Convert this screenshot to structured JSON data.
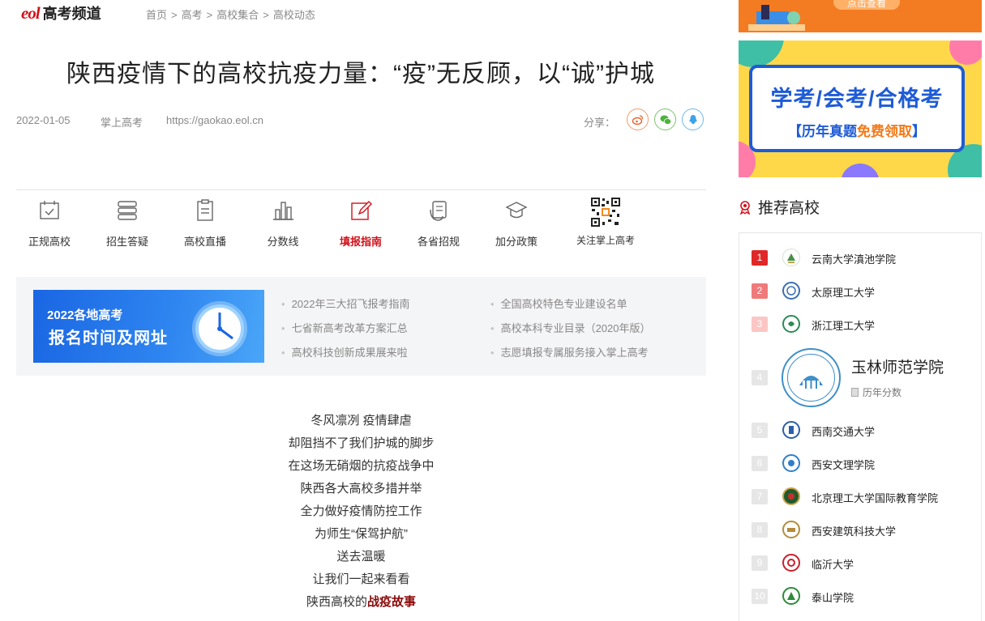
{
  "header": {
    "logo_mark": "eol",
    "channel": "高考频道",
    "breadcrumb": [
      "首页",
      "高考",
      "高校集合",
      "高校动态"
    ],
    "breadcrumb_sep": ">"
  },
  "article": {
    "title": "陕西疫情下的高校抗疫力量：“疫”无反顾，以“诚”护城",
    "date": "2022-01-05",
    "source": "掌上高考",
    "url": "https://gaokao.eol.cn",
    "share_label": "分享：",
    "share_targets": [
      "weibo-icon",
      "wechat-icon",
      "qq-icon"
    ],
    "lines": [
      "冬风凛冽 疫情肆虐",
      "却阻挡不了我们护城的脚步",
      "在这场无硝烟的抗疫战争中",
      "陕西各大高校多措并举",
      "全力做好疫情防控工作",
      "为师生“保驾护航”",
      "送去温暖",
      "让我们一起来看看"
    ],
    "last_line_prefix": "陕西高校的",
    "last_line_highlight": "战疫故事"
  },
  "nav": [
    {
      "label": "正规高校",
      "icon": "calendar-check-icon"
    },
    {
      "label": "招生答疑",
      "icon": "stack-icon"
    },
    {
      "label": "高校直播",
      "icon": "clipboard-icon"
    },
    {
      "label": "分数线",
      "icon": "bar-chart-icon"
    },
    {
      "label": "填报指南",
      "icon": "edit-icon",
      "active": true
    },
    {
      "label": "各省招规",
      "icon": "document-hand-icon"
    },
    {
      "label": "加分政策",
      "icon": "graduation-cap-icon"
    },
    {
      "label": "关注掌上高考",
      "icon": "qr-code-icon"
    }
  ],
  "promo": {
    "banner_line1": "2022各地高考",
    "banner_line2": "报名时间及网址",
    "links": [
      "2022年三大招飞报考指南",
      "全国高校特色专业建设名单",
      "七省新高考改革方案汇总",
      "高校本科专业目录（2020年版）",
      "高校科技创新成果展来啦",
      "志愿填报专属服务接入掌上高考"
    ]
  },
  "sidebar": {
    "ad_top_button": "点击查看",
    "ad2_title": "学考/会考/合格考",
    "ad2_sub_pre": "【历年真题",
    "ad2_sub_free": "免费领取",
    "ad2_sub_post": "】",
    "rec_title": "推荐高校",
    "featured": {
      "rank": "4",
      "name": "玉林师范学院",
      "sub": "历年分数"
    },
    "schools": [
      {
        "rank": "1",
        "name": "云南大学滇池学院"
      },
      {
        "rank": "2",
        "name": "太原理工大学"
      },
      {
        "rank": "3",
        "name": "浙江理工大学"
      },
      {
        "rank": "5",
        "name": "西南交通大学"
      },
      {
        "rank": "6",
        "name": "西安文理学院"
      },
      {
        "rank": "7",
        "name": "北京理工大学国际教育学院"
      },
      {
        "rank": "8",
        "name": "西安建筑科技大学"
      },
      {
        "rank": "9",
        "name": "临沂大学"
      },
      {
        "rank": "10",
        "name": "泰山学院"
      }
    ]
  },
  "colors": {
    "brand_red": "#d0121b",
    "active_nav": "#d0121b",
    "highlight_text": "#8b0b0b",
    "ad_orange": "#f37c22",
    "ad_yellow": "#ffd84a",
    "ad_blue": "#1e5bd6"
  }
}
